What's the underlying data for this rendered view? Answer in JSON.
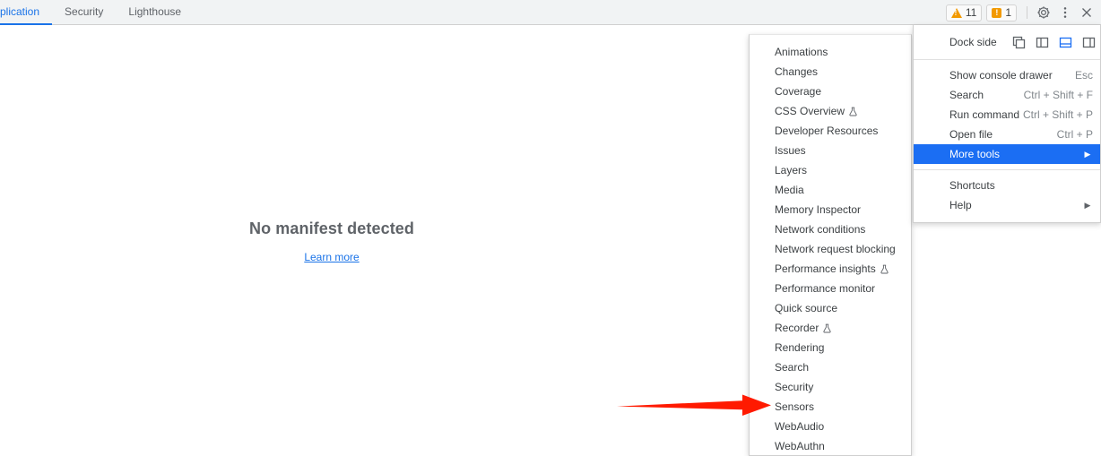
{
  "toolbar": {
    "tabs": [
      {
        "label": "plication",
        "active": true
      },
      {
        "label": "Security",
        "active": false
      },
      {
        "label": "Lighthouse",
        "active": false
      }
    ],
    "warnings": {
      "icon": "warning-triangle-icon",
      "count": "11"
    },
    "errors": {
      "icon": "error-square-icon",
      "count": "1"
    },
    "settings_icon": "gear-icon",
    "more_icon": "kebab-menu-icon",
    "close_icon": "close-icon"
  },
  "main": {
    "empty_title": "No manifest detected",
    "empty_link": "Learn more"
  },
  "menu": {
    "dock_side": {
      "label": "Dock side",
      "options": [
        {
          "name": "undock-into-separate-window",
          "selected": false
        },
        {
          "name": "dock-to-left",
          "selected": false
        },
        {
          "name": "dock-to-bottom",
          "selected": true
        },
        {
          "name": "dock-to-right",
          "selected": false
        }
      ]
    },
    "items": [
      {
        "label": "Show console drawer",
        "shortcut": "Esc",
        "submenu": false,
        "selected": false
      },
      {
        "label": "Search",
        "shortcut": "Ctrl + Shift + F",
        "submenu": false,
        "selected": false
      },
      {
        "label": "Run command",
        "shortcut": "Ctrl + Shift + P",
        "submenu": false,
        "selected": false
      },
      {
        "label": "Open file",
        "shortcut": "Ctrl + P",
        "submenu": false,
        "selected": false
      },
      {
        "label": "More tools",
        "shortcut": "",
        "submenu": true,
        "selected": true
      }
    ],
    "items_bottom": [
      {
        "label": "Shortcuts",
        "shortcut": "",
        "submenu": false,
        "selected": false
      },
      {
        "label": "Help",
        "shortcut": "",
        "submenu": true,
        "selected": false
      }
    ],
    "submenu_arrow": "▶"
  },
  "flyout": {
    "items": [
      {
        "label": "Animations",
        "experimental": false
      },
      {
        "label": "Changes",
        "experimental": false
      },
      {
        "label": "Coverage",
        "experimental": false
      },
      {
        "label": "CSS Overview",
        "experimental": true
      },
      {
        "label": "Developer Resources",
        "experimental": false
      },
      {
        "label": "Issues",
        "experimental": false
      },
      {
        "label": "Layers",
        "experimental": false
      },
      {
        "label": "Media",
        "experimental": false
      },
      {
        "label": "Memory Inspector",
        "experimental": false
      },
      {
        "label": "Network conditions",
        "experimental": false
      },
      {
        "label": "Network request blocking",
        "experimental": false
      },
      {
        "label": "Performance insights",
        "experimental": true
      },
      {
        "label": "Performance monitor",
        "experimental": false
      },
      {
        "label": "Quick source",
        "experimental": false
      },
      {
        "label": "Recorder",
        "experimental": true
      },
      {
        "label": "Rendering",
        "experimental": false
      },
      {
        "label": "Search",
        "experimental": false
      },
      {
        "label": "Security",
        "experimental": false
      },
      {
        "label": "Sensors",
        "experimental": false
      },
      {
        "label": "WebAudio",
        "experimental": false
      },
      {
        "label": "WebAuthn",
        "experimental": false
      }
    ]
  },
  "annotation": {
    "arrow_color": "#ff1a00",
    "points_to": "Sensors"
  },
  "colors": {
    "accent": "#1a73e8",
    "highlight": "#1b6ef3",
    "toolbar_bg": "#f1f3f4",
    "warning": "#f29900",
    "text": "#3c4043",
    "muted": "#80868b"
  }
}
